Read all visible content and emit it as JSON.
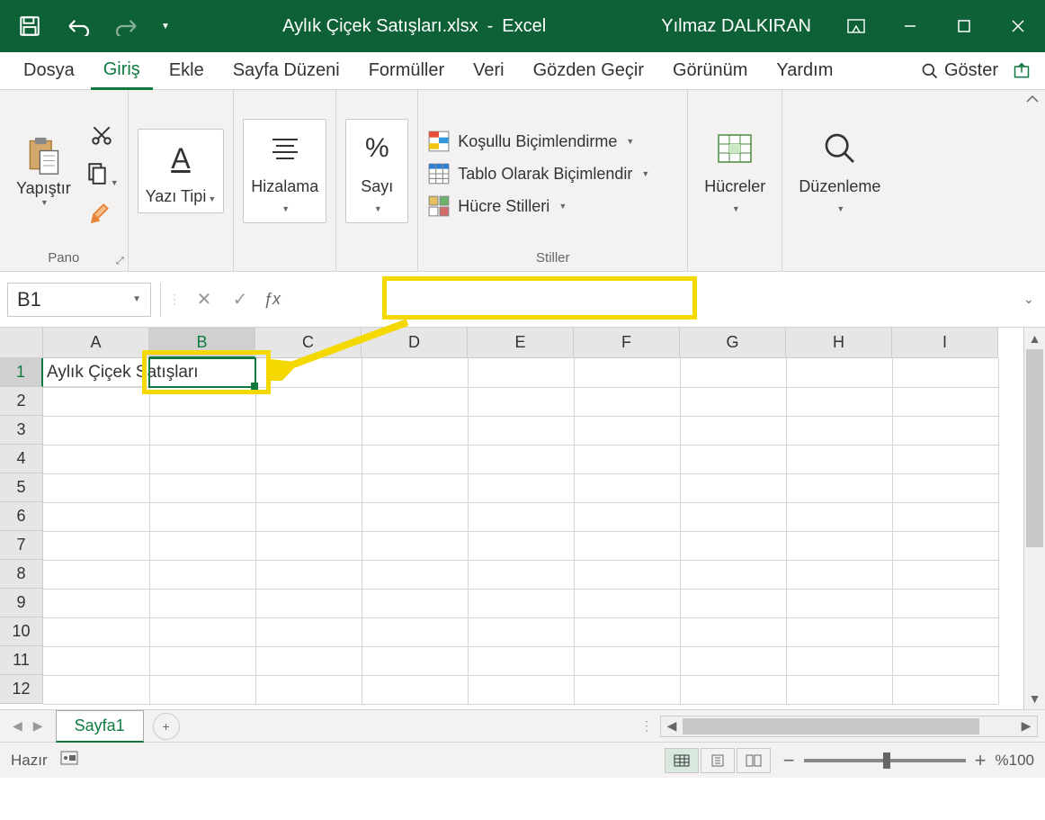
{
  "title_bar": {
    "document_name": "Aylık Çiçek Satışları.xlsx",
    "separator": "-",
    "app_name": "Excel",
    "user_name": "Yılmaz DALKIRAN"
  },
  "ribbon_tabs": {
    "items": [
      "Dosya",
      "Giriş",
      "Ekle",
      "Sayfa Düzeni",
      "Formüller",
      "Veri",
      "Gözden Geçir",
      "Görünüm",
      "Yardım"
    ],
    "active": 1,
    "tell_me": "Göster"
  },
  "ribbon": {
    "pano": {
      "label": "Pano",
      "paste": "Yapıştır"
    },
    "font": {
      "label": "Yazı Tipi"
    },
    "align": {
      "label": "Hizalama"
    },
    "number": {
      "label": "Sayı"
    },
    "styles": {
      "label": "Stiller",
      "conditional": "Koşullu Biçimlendirme",
      "table": "Tablo Olarak Biçimlendir",
      "cell": "Hücre Stilleri"
    },
    "cells": {
      "label": "Hücreler"
    },
    "editing": {
      "label": "Düzenleme"
    }
  },
  "formula_bar": {
    "name_box": "B1",
    "formula_value": ""
  },
  "grid": {
    "columns": [
      "A",
      "B",
      "C",
      "D",
      "E",
      "F",
      "G",
      "H",
      "I"
    ],
    "rows": [
      1,
      2,
      3,
      4,
      5,
      6,
      7,
      8,
      9,
      10,
      11,
      12
    ],
    "active_col": "B",
    "active_row": 1,
    "cells": {
      "A1": "Aylık Çiçek Satışları"
    }
  },
  "sheet_bar": {
    "active_sheet": "Sayfa1"
  },
  "status_bar": {
    "ready": "Hazır",
    "zoom": "%100"
  }
}
